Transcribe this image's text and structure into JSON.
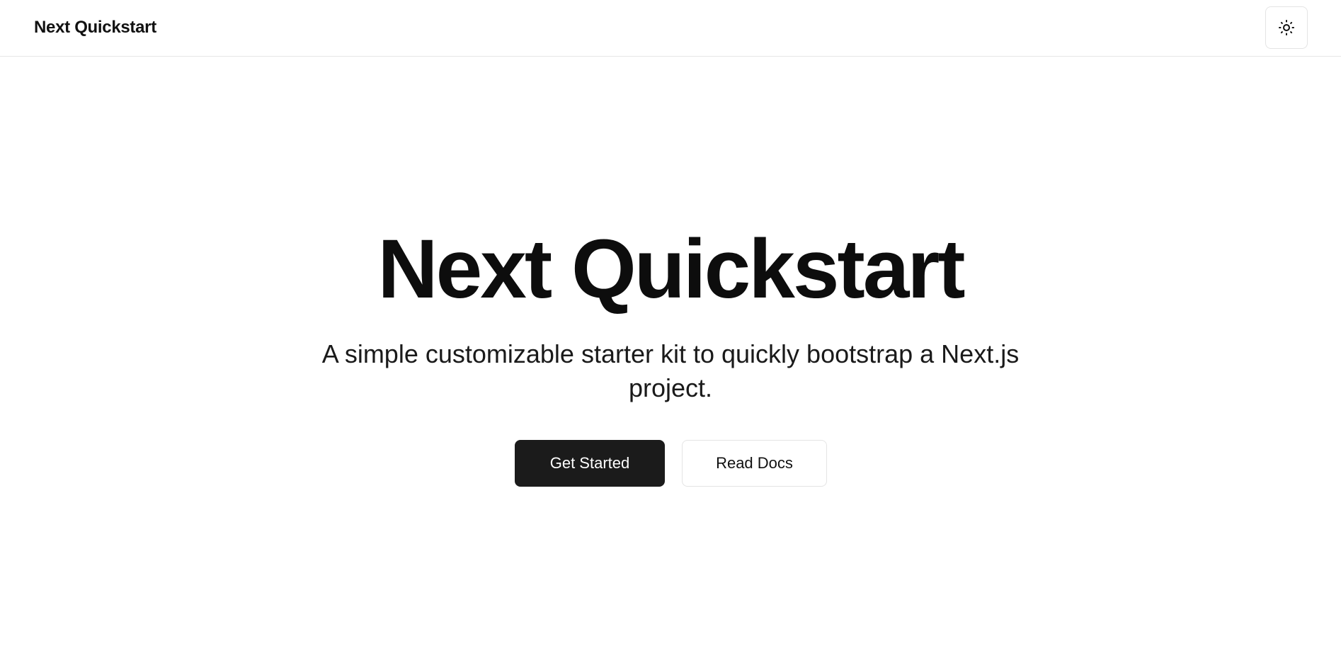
{
  "header": {
    "brand": "Next Quickstart",
    "theme_toggle_icon": "sun-icon"
  },
  "hero": {
    "title": "Next Quickstart",
    "subtitle": "A simple customizable starter kit to quickly bootstrap a Next.js project.",
    "primary_button": "Get Started",
    "secondary_button": "Read Docs"
  },
  "colors": {
    "background": "#ffffff",
    "text": "#111111",
    "primary_button_bg": "#1b1b1b",
    "primary_button_text": "#ffffff",
    "border": "#e4e4e4"
  }
}
